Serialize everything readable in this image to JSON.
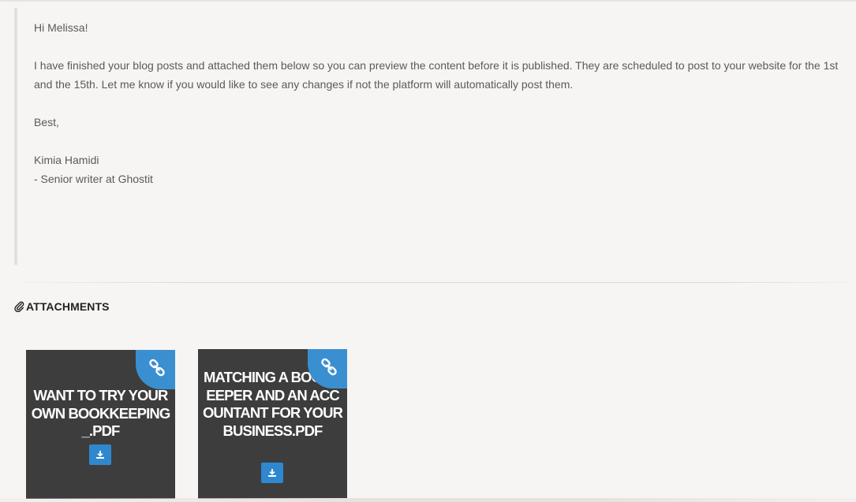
{
  "message": {
    "greeting": "Hi Melissa!",
    "body": "I have finished your blog posts and attached them below so you can preview the content before it is published. They are scheduled to post to your website for the 1st and the 15th. Let me know if you would like to see any changes if not the platform will automatically post them.",
    "closing": "Best,",
    "signature_name": "Kimia Hamidi",
    "signature_title": "- Senior writer at Ghostit"
  },
  "attachments": {
    "header_label": "ATTACHMENTS",
    "header_icon": "paperclip-icon",
    "items": [
      {
        "title": "WANT TO TRY YOUR OWN BOOKKEEPING_.PDF",
        "link_icon": "link-icon",
        "download_icon": "download-icon"
      },
      {
        "title": "MATCHING A BOOKKEEPER AND AN ACCOUNTANT FOR YOUR BUSINESS.PDF",
        "link_icon": "link-icon",
        "download_icon": "download-icon"
      }
    ]
  },
  "colors": {
    "background": "#f7f5f3",
    "card_background": "#3d3d3d",
    "accent": "#3a8fd1",
    "text": "#5a5a5a"
  }
}
